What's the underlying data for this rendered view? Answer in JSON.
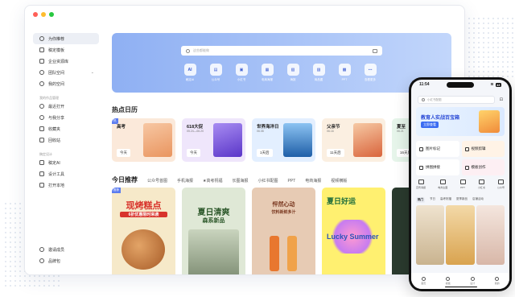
{
  "sidebar": {
    "items_top": [
      {
        "label": "为你推荐",
        "icon": "compass-icon"
      },
      {
        "label": "稿定模板",
        "icon": "template-icon"
      },
      {
        "label": "企业资源库",
        "icon": "library-icon"
      },
      {
        "label": "团队空间",
        "icon": "team-icon"
      },
      {
        "label": "我的空间",
        "icon": "user-icon"
      }
    ],
    "section_recent": "我的作品管理",
    "items_mid": [
      {
        "label": "最近打开",
        "icon": "clock-icon"
      },
      {
        "label": "与我分享",
        "icon": "share-icon"
      },
      {
        "label": "收藏夹",
        "icon": "star-icon"
      },
      {
        "label": "回收站",
        "icon": "trash-icon"
      }
    ],
    "section_design": "稿定设计",
    "items_tools": [
      {
        "label": "稿定AI",
        "icon": "ai-icon"
      },
      {
        "label": "设计工具",
        "icon": "tools-icon"
      },
      {
        "label": "打开本地",
        "icon": "folder-icon"
      }
    ],
    "items_bottom": [
      {
        "label": "邀请成员",
        "icon": "invite-icon"
      },
      {
        "label": "品牌包",
        "icon": "brand-icon"
      }
    ]
  },
  "banner": {
    "search_placeholder": "这些都能做",
    "quick": [
      {
        "glyph": "AI",
        "label": "稿定AI"
      },
      {
        "glyph": "▤",
        "label": "公众号"
      },
      {
        "glyph": "▣",
        "label": "小红书"
      },
      {
        "glyph": "▦",
        "label": "电商海报"
      },
      {
        "glyph": "▧",
        "label": "海报"
      },
      {
        "glyph": "▨",
        "label": "商品图"
      },
      {
        "glyph": "▩",
        "label": "PPT"
      },
      {
        "glyph": "⋯",
        "label": "查看更多"
      }
    ]
  },
  "calendar": {
    "title": "热点日历",
    "cards": [
      {
        "name": "高考",
        "date": "",
        "badge": "今天",
        "tag": "热",
        "bg": "#fbe9da",
        "art": "#f3b98d"
      },
      {
        "name": "618大促",
        "date": "05.24—06.20",
        "badge": "今天",
        "tag": "",
        "bg": "#efe6fb",
        "art": "#7a5be0"
      },
      {
        "name": "世界海洋日",
        "date": "06.08",
        "badge": "1天后",
        "tag": "",
        "bg": "#e3efff",
        "art": "#3f86d8"
      },
      {
        "name": "父亲节",
        "date": "06.16",
        "badge": "11天后",
        "tag": "",
        "bg": "#fbefe1",
        "art": "#e67a4f"
      },
      {
        "name": "夏至",
        "date": "06.21",
        "badge": "16天后",
        "tag": "",
        "bg": "#e6f5ea",
        "art": "#9fd1a6"
      }
    ]
  },
  "recommend": {
    "title": "今日推荐",
    "tabs": [
      "公众号首图",
      "手机海报",
      "★高考祝福",
      "长图海报",
      "小红书配图",
      "PPT",
      "电商海报",
      "视频横版"
    ]
  },
  "posters": [
    {
      "headline": "现烤糕点",
      "sub": "6折优惠限时来袭",
      "bg": "#f6e9c9",
      "accent": "#d8332b",
      "tag": "推荐"
    },
    {
      "headline": "夏日清爽",
      "sub": "森系新品",
      "bg": "#dfe8d6",
      "accent": "#2f5a2d",
      "tag": ""
    },
    {
      "headline": "怦然心动",
      "sub": "饮料新鲜多汁",
      "bg": "#e7cbb4",
      "accent": "#7b3a22",
      "tag": ""
    },
    {
      "headline": "夏日好运",
      "sub": "Lucky Summer",
      "bg": "#fff070",
      "accent": "#3a6fb8",
      "tag": ""
    },
    {
      "headline": "",
      "sub": "",
      "bg": "#2a3a2e",
      "accent": "#9fbf7a",
      "tag": ""
    }
  ],
  "phone": {
    "time": "11:54",
    "battery": "43",
    "search_placeholder": "小红书配图",
    "banner_title": "教育人实战百宝箱",
    "banner_btn": "立即查看",
    "cards": [
      {
        "label": "图片标记",
        "tone": "plain"
      },
      {
        "label": "视频剪辑",
        "tone": "warm"
      },
      {
        "label": "拼图拼接",
        "tone": "plain"
      },
      {
        "label": "模板创作",
        "tone": "pink"
      }
    ],
    "icons": [
      "宣传海报",
      "电商主图",
      "PPT",
      "小红书",
      "公众号"
    ],
    "tabs": [
      "热门",
      "节日",
      "高考祝福",
      "夏季新品",
      "店铺活动"
    ],
    "nav": [
      "首页",
      "模板",
      "设计",
      "我的"
    ]
  },
  "colors": {
    "accent": "#3b6cf2",
    "traffic_red": "#ff5f57",
    "traffic_yellow": "#febc2e",
    "traffic_green": "#28c840"
  }
}
